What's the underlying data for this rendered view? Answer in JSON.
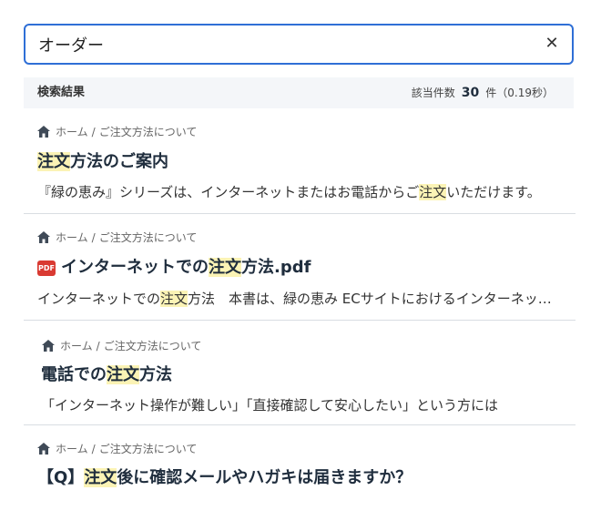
{
  "search": {
    "value": "オーダー",
    "placeholder": ""
  },
  "summary": {
    "label": "検索結果",
    "count_prefix": "該当件数",
    "count": "30",
    "count_suffix": "件（0.19秒）"
  },
  "breadcrumb": {
    "home": "ホーム",
    "separator": "/",
    "section": "ご注文方法について"
  },
  "results": [
    {
      "title_pre": "",
      "title_mark": "注文",
      "title_post": "方法のご案内",
      "snippet_pre": "『緑の恵み』シリーズは、インターネットまたはお電話からご",
      "snippet_mark": "注文",
      "snippet_post": "いただけます。"
    },
    {
      "title_pre": "インターネットでの",
      "title_mark": "注文",
      "title_post": "方法.pdf",
      "pdf_label": "PDF",
      "snippet_pre": "インターネットでの",
      "snippet_mark": "注文",
      "snippet_post": "方法　本書は、緑の恵み ECサイトにおけるインターネット注文の"
    },
    {
      "title_pre": "電話での",
      "title_mark": "注文",
      "title_post": "方法",
      "snippet_pre": "「インターネット操作が難しい」「直接確認して安心したい」という方には",
      "snippet_mark": "",
      "snippet_post": ""
    },
    {
      "title_pre": "【Q】",
      "title_mark": "注文",
      "title_post": "後に確認メールやハガキは届きますか？"
    }
  ],
  "colors": {
    "accent": "#2f6fd6",
    "highlight": "#fbf3b5",
    "pdf": "#d93a32"
  },
  "icons": {
    "home": "home-icon",
    "clear": "close-icon",
    "pdf": "pdf-icon"
  }
}
